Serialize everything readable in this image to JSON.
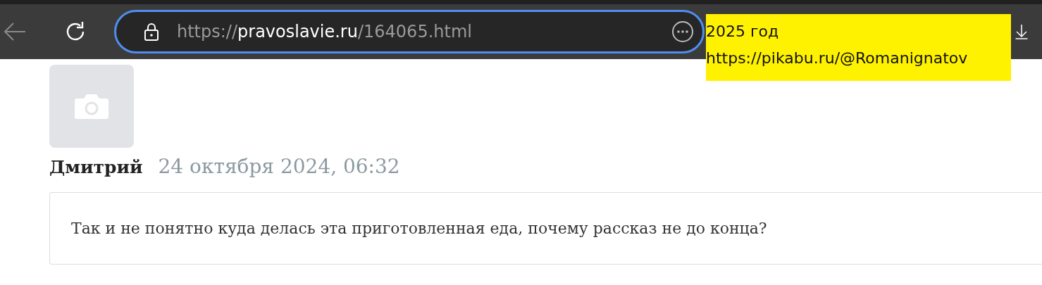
{
  "browser": {
    "url": {
      "scheme": "https://",
      "host": "pravoslavie.ru",
      "path": "/164065.html"
    }
  },
  "note": {
    "lines": [
      "2025 год",
      "https://pikabu.ru/@Romanignatov"
    ]
  },
  "comment": {
    "author": "Дмитрий",
    "date": "24 октября 2024, 06:32",
    "text": "Так и не понятно куда делась эта приготовленная еда, почему рассказ не до конца?"
  }
}
